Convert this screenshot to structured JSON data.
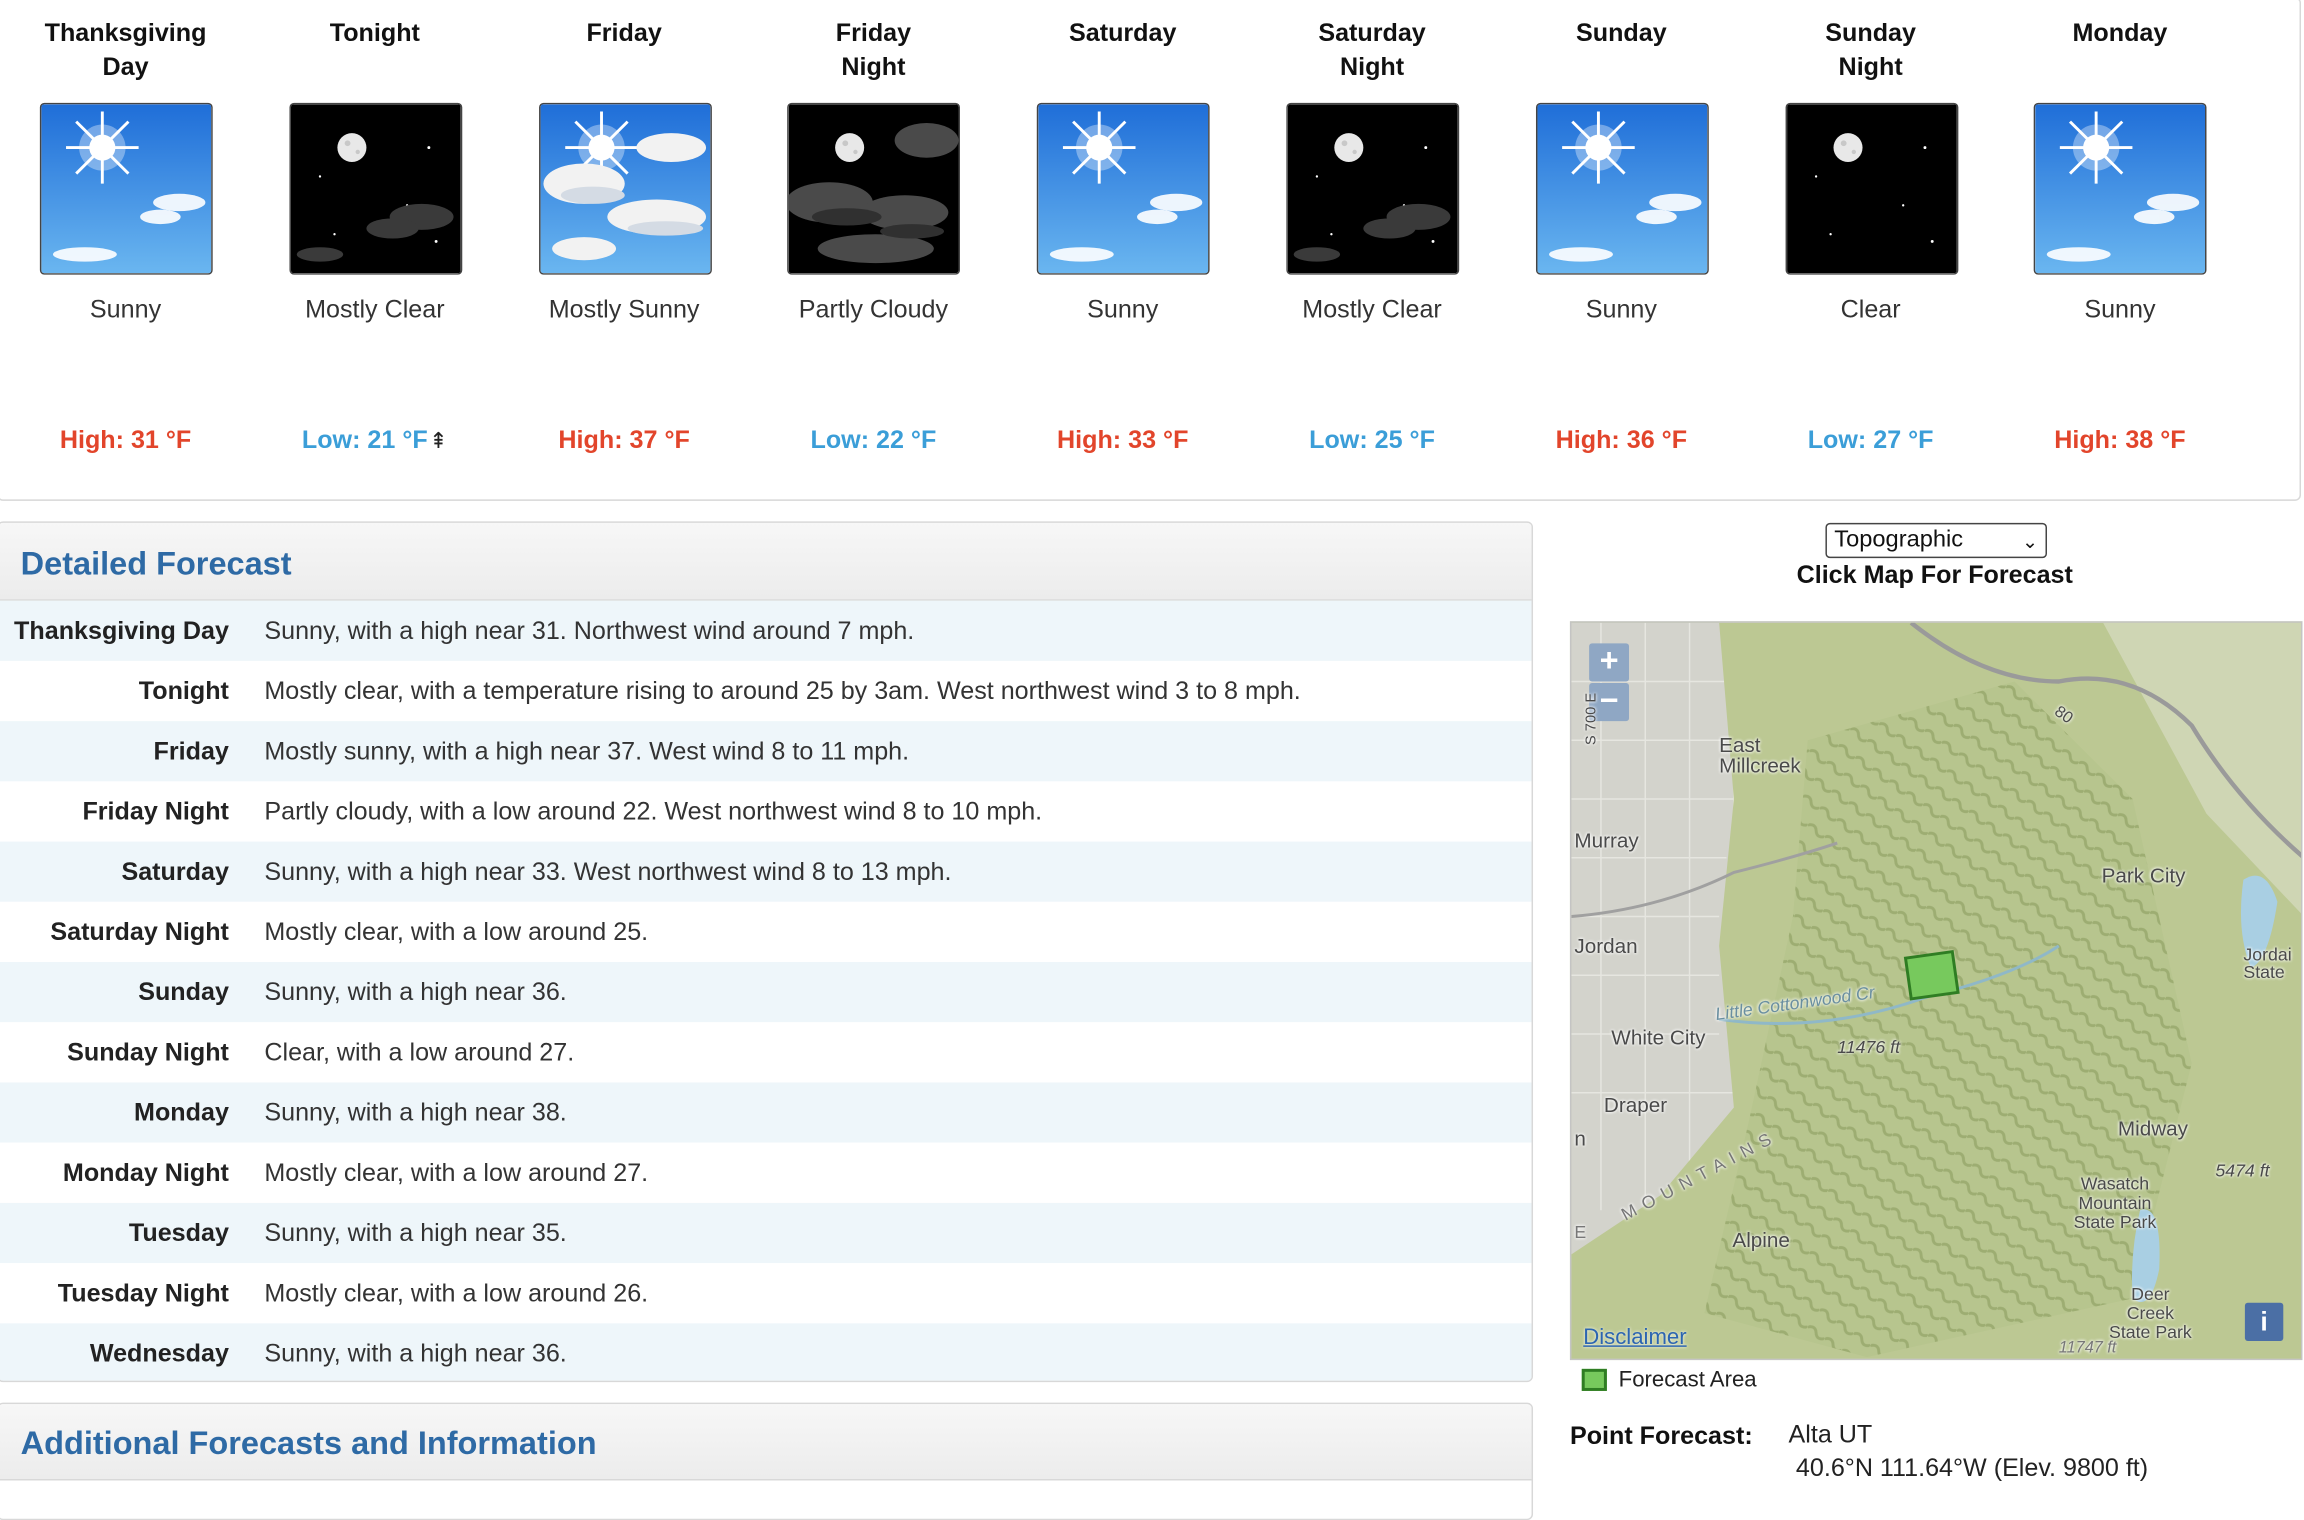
{
  "periods": [
    {
      "name": "Thanksgiving Day",
      "short": "Sunny",
      "temp": "High: 31 °F",
      "kind": "high",
      "icon": "sunny-icon"
    },
    {
      "name": "Tonight",
      "short": "Mostly Clear",
      "temp": "Low: 21 °F",
      "kind": "low",
      "icon": "mostly-clear-night-icon"
    },
    {
      "name": "Friday",
      "short": "Mostly Sunny",
      "temp": "High: 37 °F",
      "kind": "high",
      "icon": "mostly-sunny-icon"
    },
    {
      "name": "Friday Night",
      "short": "Partly Cloudy",
      "temp": "Low: 22 °F",
      "kind": "low",
      "icon": "partly-cloudy-night-icon"
    },
    {
      "name": "Saturday",
      "short": "Sunny",
      "temp": "High: 33 °F",
      "kind": "high",
      "icon": "sunny-icon"
    },
    {
      "name": "Saturday Night",
      "short": "Mostly Clear",
      "temp": "Low: 25 °F",
      "kind": "low",
      "icon": "mostly-clear-night-icon"
    },
    {
      "name": "Sunday",
      "short": "Sunny",
      "temp": "High: 36 °F",
      "kind": "high",
      "icon": "sunny-icon"
    },
    {
      "name": "Sunday Night",
      "short": "Clear",
      "temp": "Low: 27 °F",
      "kind": "low",
      "icon": "clear-night-icon"
    },
    {
      "name": "Monday",
      "short": "Sunny",
      "temp": "High: 38 °F",
      "kind": "high",
      "icon": "sunny-icon"
    }
  ],
  "detailed": {
    "title": "Detailed Forecast",
    "rows": [
      {
        "label": "Thanksgiving Day",
        "text": "Sunny, with a high near 31. Northwest wind around 7 mph."
      },
      {
        "label": "Tonight",
        "text": "Mostly clear, with a temperature rising to around 25 by 3am. West northwest wind 3 to 8 mph."
      },
      {
        "label": "Friday",
        "text": "Mostly sunny, with a high near 37. West wind 8 to 11 mph."
      },
      {
        "label": "Friday Night",
        "text": "Partly cloudy, with a low around 22. West northwest wind 8 to 10 mph."
      },
      {
        "label": "Saturday",
        "text": "Sunny, with a high near 33. West northwest wind 8 to 13 mph."
      },
      {
        "label": "Saturday Night",
        "text": "Mostly clear, with a low around 25."
      },
      {
        "label": "Sunday",
        "text": "Sunny, with a high near 36."
      },
      {
        "label": "Sunday Night",
        "text": "Clear, with a low around 27."
      },
      {
        "label": "Monday",
        "text": "Sunny, with a high near 38."
      },
      {
        "label": "Monday Night",
        "text": "Mostly clear, with a low around 27."
      },
      {
        "label": "Tuesday",
        "text": "Sunny, with a high near 35."
      },
      {
        "label": "Tuesday Night",
        "text": "Mostly clear, with a low around 26."
      },
      {
        "label": "Wednesday",
        "text": "Sunny, with a high near 36."
      }
    ]
  },
  "additional": {
    "title": "Additional Forecasts and Information"
  },
  "map": {
    "select_value": "Topographic",
    "caption": "Click Map For Forecast",
    "zoom_in": "+",
    "zoom_out": "−",
    "disclaimer": "Disclaimer",
    "info": "i",
    "legend": "Forecast Area",
    "labels": {
      "east_millcreek": "East\nMillcreek",
      "murray": "Murray",
      "jordan": "Jordan",
      "white_city": "White City",
      "draper": "Draper",
      "alpine": "Alpine",
      "park_city": "Park City",
      "midway": "Midway",
      "wasatch": "Wasatch\nMountain\nState Park",
      "deer_creek": "Deer\nCreek\nState Park",
      "jordanelle": "Jordai\nState",
      "little_cottonwood": "Little Cottonwood Cr",
      "elev_11476": "11476 ft",
      "elev_5474": "5474 ft",
      "elev_11747": "11747 ft",
      "route_80": "80",
      "street_s700e": "S 700 E",
      "mountains": "M O U N T A I N S",
      "edge_n": "n",
      "edge_e": "E"
    }
  },
  "point_forecast": {
    "label": "Point Forecast:",
    "place": "Alta UT",
    "coords": "40.6°N 111.64°W (Elev. 9800 ft)"
  },
  "colors": {
    "high": "#e2452b",
    "low": "#3b9ed8",
    "heading": "#2e6aa5",
    "forecast_area": "#77c95d"
  }
}
